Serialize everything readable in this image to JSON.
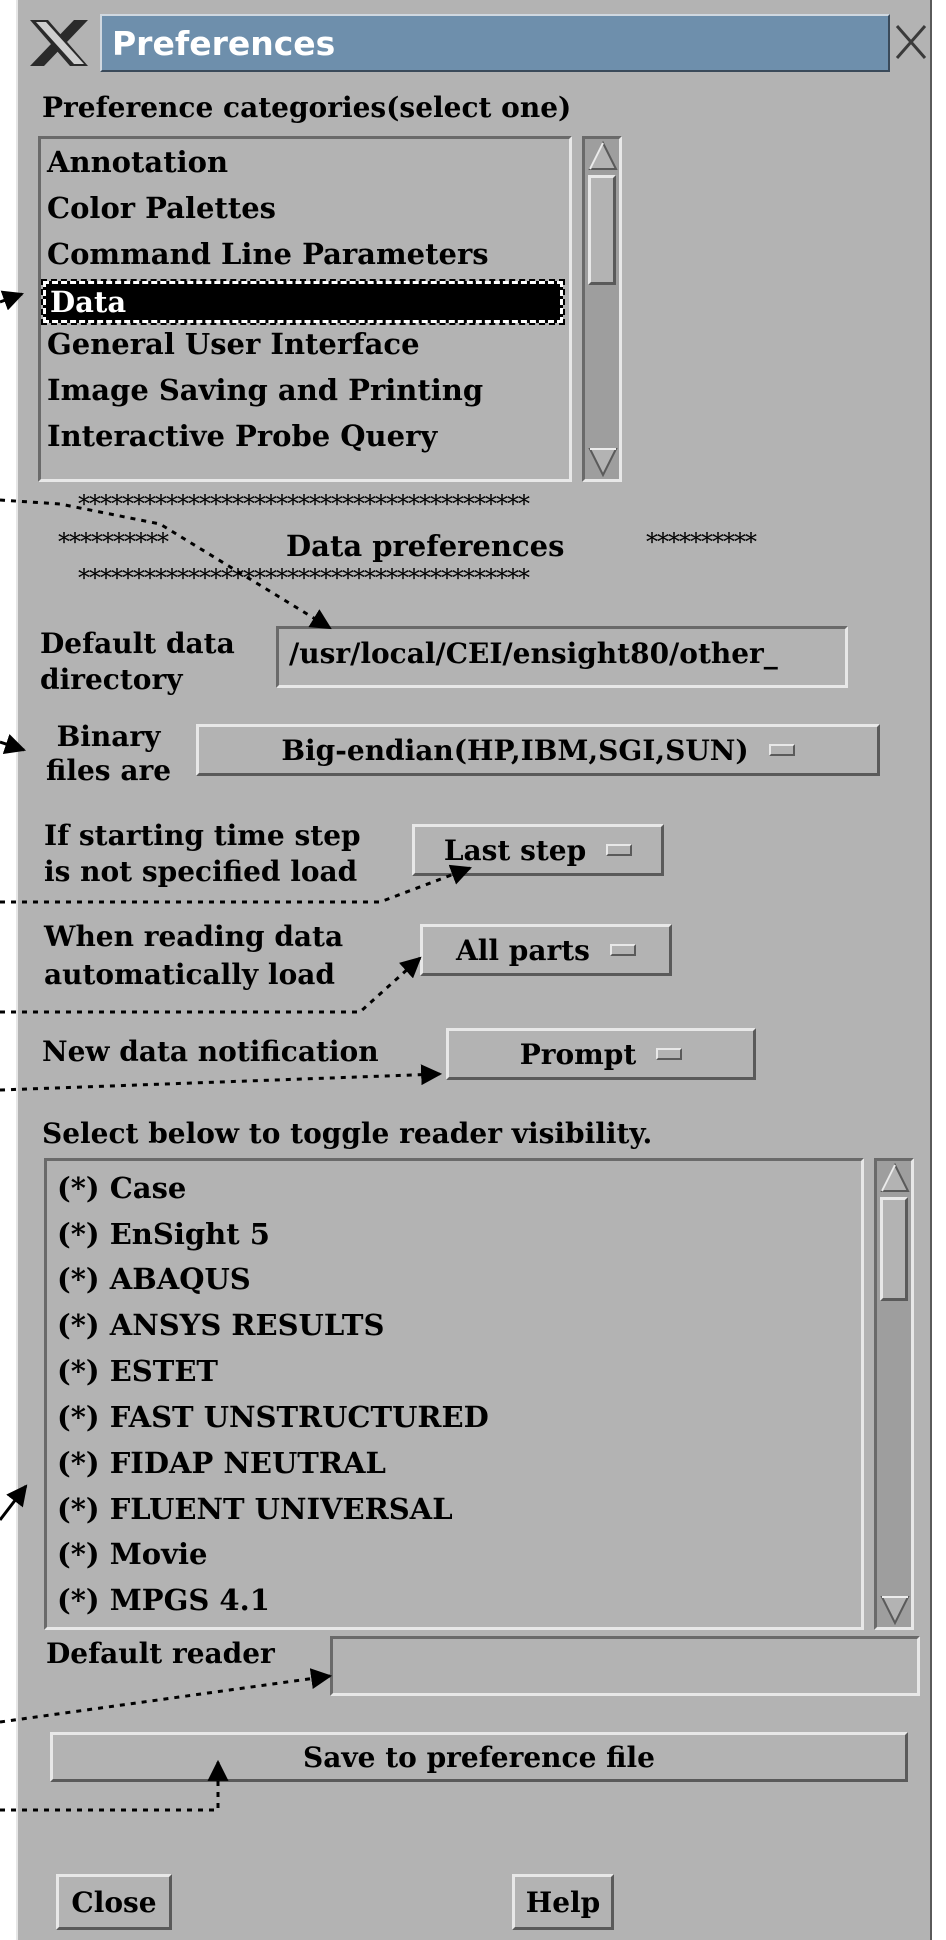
{
  "window": {
    "title": "Preferences",
    "title_bar_color": "#6e8fac",
    "background": "#b3b3b3"
  },
  "categories": {
    "header": "Preference categories(select one)",
    "items": [
      "Annotation",
      "Color Palettes",
      "Command Line Parameters",
      "Data",
      "General User Interface",
      "Image Saving and Printing",
      "Interactive Probe Query"
    ],
    "selected": "Data"
  },
  "section_banner": {
    "stars_top": "*****************************************",
    "stars_left": "**********",
    "title": "Data preferences",
    "stars_right": "**********",
    "stars_bottom": "*****************************************"
  },
  "default_dir": {
    "label_line1": "Default data",
    "label_line2": "directory",
    "value": "/usr/local/CEI/ensight80/other_"
  },
  "binary_files": {
    "label_line1": "Binary",
    "label_line2": "files are",
    "value": "Big-endian(HP,IBM,SGI,SUN)"
  },
  "start_step": {
    "label_line1": "If starting time step",
    "label_line2": "is not specified load",
    "value": "Last step"
  },
  "auto_load": {
    "label_line1": "When reading data",
    "label_line2": "automatically load",
    "value": "All parts"
  },
  "notification": {
    "label": "New data notification",
    "value": "Prompt"
  },
  "readers": {
    "header": "Select below to toggle reader visibility.",
    "items": [
      "(*) Case",
      "(*) EnSight 5",
      "(*) ABAQUS",
      "(*) ANSYS RESULTS",
      "(*) ESTET",
      "(*) FAST UNSTRUCTURED",
      "(*) FIDAP NEUTRAL",
      "(*) FLUENT UNIVERSAL",
      "(*) Movie",
      "(*) MPGS 4.1"
    ]
  },
  "default_reader": {
    "label": "Default reader",
    "value": ""
  },
  "buttons": {
    "save": "Save to preference file",
    "close": "Close",
    "help": "Help"
  }
}
